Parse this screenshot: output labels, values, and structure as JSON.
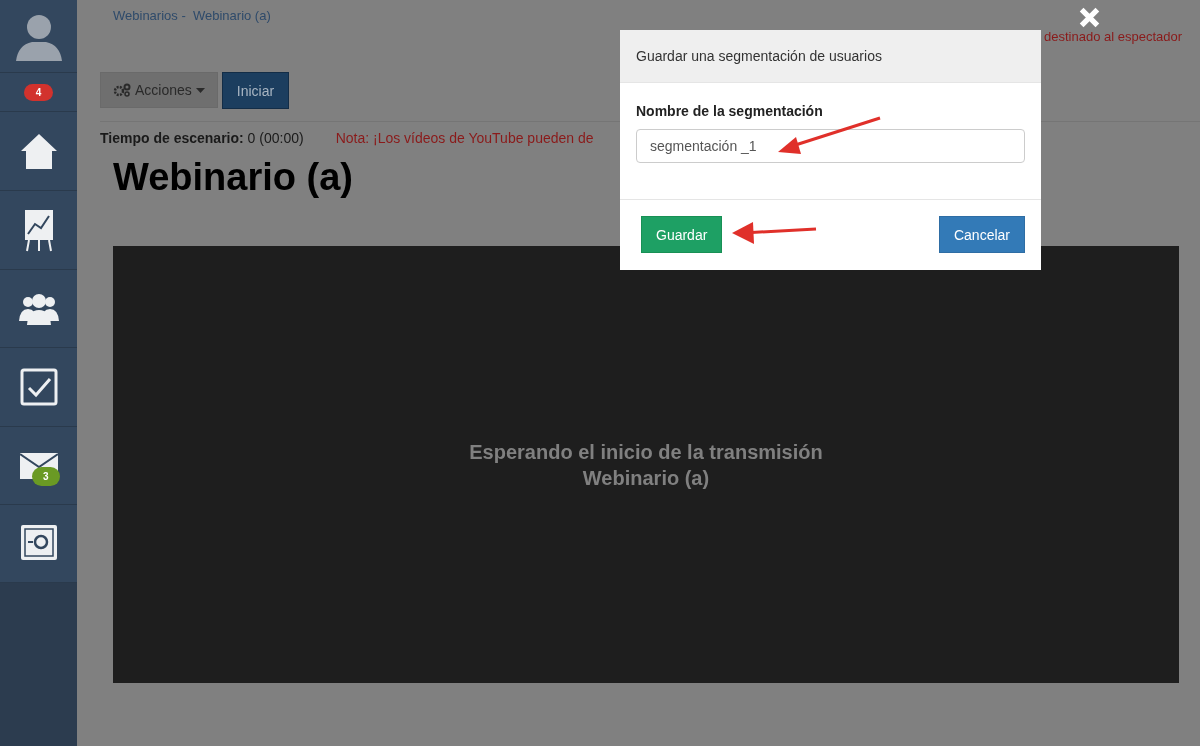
{
  "sidebar": {
    "items": [
      {
        "kind": "avatar"
      },
      {
        "kind": "badge",
        "badge": "4",
        "color": "#d2322d"
      },
      {
        "kind": "home"
      },
      {
        "kind": "chart"
      },
      {
        "kind": "users"
      },
      {
        "kind": "check"
      },
      {
        "kind": "mail",
        "badge": "3",
        "color": "#6a9a24"
      },
      {
        "kind": "safe"
      }
    ]
  },
  "breadcrumb": "Webinarios -  Webinario (a)",
  "top_notice": "destinado al espectador",
  "toolbar": {
    "actions": "Acciones",
    "start": "Iniciar"
  },
  "info": {
    "label": "Tiempo de escenario:",
    "value": "0 (00:00)",
    "note": "Nota: ¡Los vídeos de YouTube pueden de"
  },
  "title": "Webinario (a)",
  "video": {
    "lines": [
      "Esperando el inicio de la transmisión",
      "Webinario (a)"
    ]
  },
  "modal": {
    "title": "Guardar una segmentación de usuarios",
    "field_label": "Nombre de la segmentación",
    "field_value": "segmentación _1",
    "save": "Guardar",
    "cancel": "Cancelar"
  }
}
